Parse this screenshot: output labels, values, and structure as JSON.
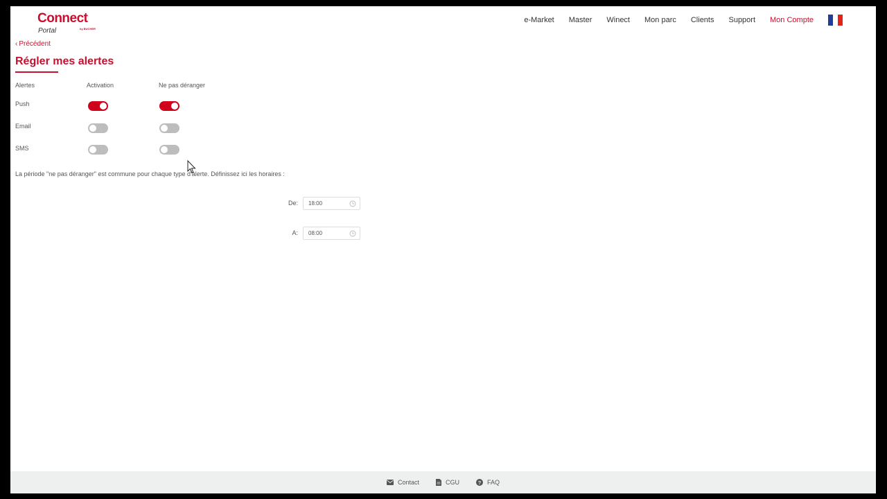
{
  "header": {
    "logo": {
      "main": "Connect",
      "sub": "Portal",
      "by": "by BUCHER"
    },
    "nav": [
      {
        "label": "e-Market",
        "active": false
      },
      {
        "label": "Master",
        "active": false
      },
      {
        "label": "Winect",
        "active": false
      },
      {
        "label": "Mon parc",
        "active": false
      },
      {
        "label": "Clients",
        "active": false
      },
      {
        "label": "Support",
        "active": false
      },
      {
        "label": "Mon Compte",
        "active": true
      }
    ],
    "language_flag": "fr"
  },
  "page": {
    "back_label": "Précédent",
    "title": "Régler mes alertes",
    "columns": {
      "alerts": "Alertes",
      "activation": "Activation",
      "dnd": "Ne pas déranger"
    },
    "rows": [
      {
        "label": "Push",
        "activation": true,
        "dnd": true
      },
      {
        "label": "Email",
        "activation": false,
        "dnd": false
      },
      {
        "label": "SMS",
        "activation": false,
        "dnd": false
      }
    ],
    "info_text": "La période \"ne pas déranger\" est commune pour chaque type d'alerte. Définissez ici les horaires :",
    "from_label": "De:",
    "from_value": "18:00",
    "to_label": "A:",
    "to_value": "08:00"
  },
  "footer": {
    "contact": "Contact",
    "cgu": "CGU",
    "faq": "FAQ"
  },
  "colors": {
    "accent": "#c8102e",
    "toggle_on": "#d0021b",
    "toggle_off": "#bdbdbd"
  }
}
